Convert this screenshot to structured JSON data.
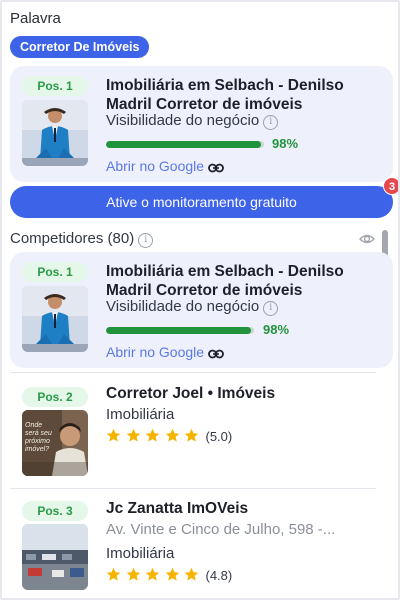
{
  "keyword_section": {
    "label": "Palavra",
    "chip": "Corretor De Imóveis"
  },
  "main_business": {
    "position": "Pos. 1",
    "name_line1": "Imobiliária em Selbach - Denilso",
    "name_line2": "Madril Corretor de imóveis",
    "visibility_label": "Visibilidade do negócio",
    "visibility_pct_text": "98%",
    "visibility_value": 98,
    "google_link": "Abrir no Google"
  },
  "cta": {
    "label": "Ative o monitoramento gratuito",
    "badge_count": "3"
  },
  "competitors": {
    "header": "Competidores (80)",
    "items": [
      {
        "position": "Pos. 1",
        "name_line1": "Imobiliária em Selbach - Denilso",
        "name_line2": "Madril Corretor de imóveis",
        "visibility_label": "Visibilidade do negócio",
        "visibility_pct_text": "98%",
        "visibility_value": 98,
        "google_link": "Abrir no Google"
      },
      {
        "position": "Pos. 2",
        "name": "Corretor Joel • Imóveis",
        "category": "Imobiliária",
        "rating": 5.0,
        "rating_text": "(5.0)",
        "thumb_text": "Onde será seu próximo imóvel?"
      },
      {
        "position": "Pos. 3",
        "name": "Jc Zanatta ImOVeis",
        "address": "Av. Vinte e Cinco de Julho, 598 -...",
        "category": "Imobiliária",
        "rating": 4.8,
        "rating_text": "(4.8)"
      }
    ]
  },
  "colors": {
    "accent": "#3d63e8",
    "success": "#22933d",
    "badge_bg": "#e4f7e8",
    "card_bg": "#eef1fb",
    "star": "#f5b400",
    "notification": "#e5484d"
  }
}
